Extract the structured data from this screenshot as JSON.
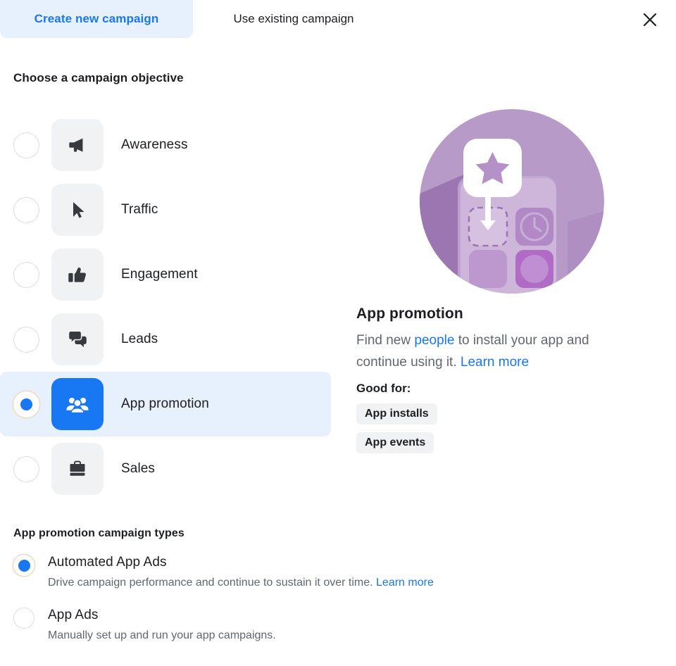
{
  "header": {
    "tabs": [
      {
        "label": "Create new campaign",
        "active": true
      },
      {
        "label": "Use existing campaign",
        "active": false
      }
    ],
    "close_icon": "close-icon"
  },
  "objective_section": {
    "title": "Choose a campaign objective",
    "items": [
      {
        "label": "Awareness",
        "icon": "megaphone-icon",
        "selected": false
      },
      {
        "label": "Traffic",
        "icon": "cursor-arrow-icon",
        "selected": false
      },
      {
        "label": "Engagement",
        "icon": "thumbs-up-icon",
        "selected": false
      },
      {
        "label": "Leads",
        "icon": "chat-bubbles-icon",
        "selected": false
      },
      {
        "label": "App promotion",
        "icon": "people-group-icon",
        "selected": true
      },
      {
        "label": "Sales",
        "icon": "briefcase-icon",
        "selected": false
      }
    ]
  },
  "info_panel": {
    "illustration": "app-install-illustration",
    "title": "App promotion",
    "description_part1": "Find new ",
    "description_link1": "people",
    "description_part2": " to install your app and continue using it. ",
    "description_link2": "Learn more",
    "good_for_label": "Good for:",
    "chips": [
      "App installs",
      "App events"
    ]
  },
  "types_section": {
    "title": "App promotion campaign types",
    "options": [
      {
        "label": "Automated App Ads",
        "description": "Drive campaign performance and continue to sustain it over time. ",
        "link": "Learn more",
        "selected": true
      },
      {
        "label": "App Ads",
        "description": "Manually set up and run your app campaigns.",
        "link": "",
        "selected": false
      }
    ]
  },
  "colors": {
    "accent_blue": "#1877f2",
    "selected_row_bg": "#e7f0fd",
    "tile_bg": "#f1f2f4",
    "text_primary": "#1c1e21",
    "text_secondary": "#606770",
    "illustration_purple": "#b79ac8",
    "illustration_purple_dark": "#9b76b0"
  }
}
